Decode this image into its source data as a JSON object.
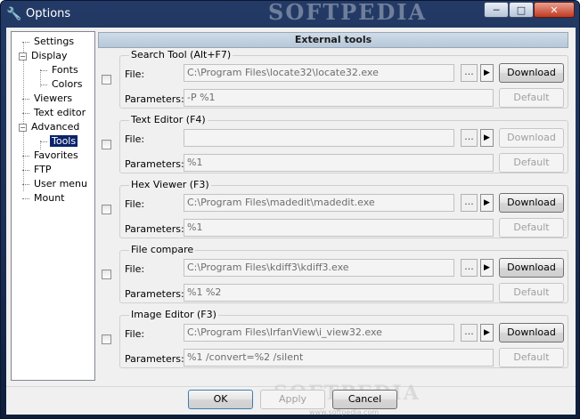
{
  "window": {
    "title": "Options",
    "watermark": "SOFTPEDIA",
    "min_glyph": "─",
    "max_glyph": "□",
    "close_glyph": "✕"
  },
  "tree": [
    {
      "label": "Settings"
    },
    {
      "label": "Display",
      "toggle": "−"
    },
    {
      "label": "Fonts"
    },
    {
      "label": "Colors"
    },
    {
      "label": "Viewers"
    },
    {
      "label": "Text editor"
    },
    {
      "label": "Advanced",
      "toggle": "−"
    },
    {
      "label": "Tools",
      "selected": true
    },
    {
      "label": "Favorites"
    },
    {
      "label": "FTP"
    },
    {
      "label": "User menu"
    },
    {
      "label": "Mount"
    }
  ],
  "panel": {
    "header": "External tools",
    "file_label": "File:",
    "params_label": "Parameters:",
    "browse_label": "...",
    "arrow_glyph": "▶",
    "download_label": "Download",
    "default_label": "Default",
    "tools": [
      {
        "name": "Search Tool (Alt+F7)",
        "file": "C:\\Program Files\\locate32\\locate32.exe",
        "params": "-P %1",
        "download_enabled": true
      },
      {
        "name": "Text Editor (F4)",
        "file": "",
        "params": "%1",
        "download_enabled": false
      },
      {
        "name": "Hex Viewer (F3)",
        "file": "C:\\Program Files\\madedit\\madedit.exe",
        "params": "%1",
        "download_enabled": true
      },
      {
        "name": "File compare",
        "file": "C:\\Program Files\\kdiff3\\kdiff3.exe",
        "params": "%1 %2",
        "download_enabled": true
      },
      {
        "name": "Image Editor (F3)",
        "file": "C:\\Program Files\\IrfanView\\i_view32.exe",
        "params": "%1 /convert=%2 /silent",
        "download_enabled": true
      }
    ]
  },
  "buttons": {
    "ok": "OK",
    "apply": "Apply",
    "cancel": "Cancel"
  },
  "watermark_bottom": {
    "text": "SOFTPEDIA",
    "url": "www.softpedia.com"
  }
}
